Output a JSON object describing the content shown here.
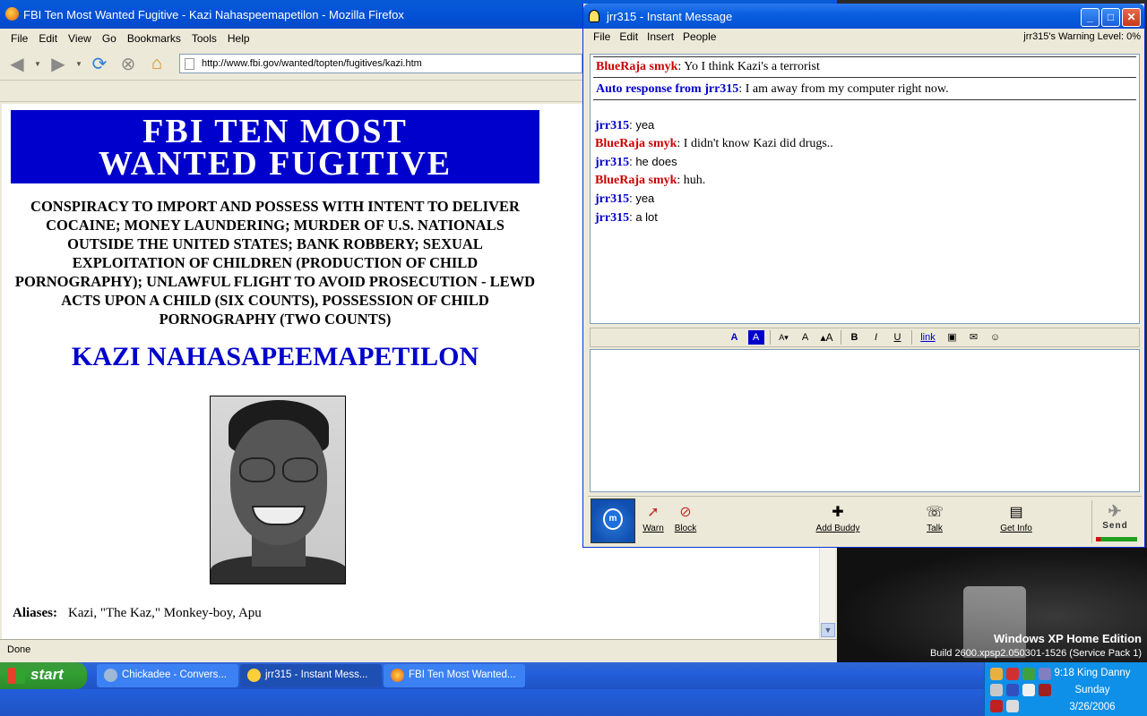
{
  "firefox": {
    "title": "FBI Ten Most Wanted Fugitive - Kazi Nahaspeemapetilon - Mozilla Firefox",
    "menu": [
      "File",
      "Edit",
      "View",
      "Go",
      "Bookmarks",
      "Tools",
      "Help"
    ],
    "url": "http://www.fbi.gov/wanted/topten/fugitives/kazi.htm",
    "status": "Done",
    "page": {
      "banner_line1": "FBI TEN MOST",
      "banner_line2": "WANTED FUGITIVE",
      "charges": "CONSPIRACY TO IMPORT AND POSSESS WITH INTENT TO DELIVER COCAINE; MONEY LAUNDERING; MURDER OF U.S. NATIONALS OUTSIDE THE UNITED STATES; BANK ROBBERY; SEXUAL EXPLOITATION OF CHILDREN (PRODUCTION OF CHILD PORNOGRAPHY); UNLAWFUL FLIGHT TO AVOID PROSECUTION - LEWD ACTS UPON A CHILD (SIX COUNTS), POSSESSION OF CHILD PORNOGRAPHY (TWO COUNTS)",
      "fugitive_name": "KAZI NAHASAPEEMAPETILON",
      "aliases_label": "Aliases:",
      "aliases_value": "Kazi, \"The Kaz,\" Monkey-boy, Apu"
    }
  },
  "aim": {
    "title": "jrr315 - Instant Message",
    "menu": [
      "File",
      "Edit",
      "Insert",
      "People"
    ],
    "warning_level": "jrr315's Warning Level: 0%",
    "boxed_messages": [
      {
        "nick": "BlueRaja smyk",
        "color": "red",
        "text": " Yo I think Kazi's a terrorist"
      },
      {
        "nick": "Auto response from jrr315",
        "color": "blue",
        "text": " I am away from my computer right now."
      }
    ],
    "messages": [
      {
        "nick": "jrr315",
        "color": "blue",
        "text": " yea",
        "serif": false
      },
      {
        "nick": "BlueRaja smyk",
        "color": "red",
        "text": " I didn't know Kazi did drugs..",
        "serif": true
      },
      {
        "nick": "jrr315",
        "color": "blue",
        "text": " he does",
        "serif": false
      },
      {
        "nick": "BlueRaja smyk",
        "color": "red",
        "text": " huh.",
        "serif": true
      },
      {
        "nick": "jrr315",
        "color": "blue",
        "text": " yea",
        "serif": false
      },
      {
        "nick": "jrr315",
        "color": "blue",
        "text": " a lot",
        "serif": false
      }
    ],
    "format_link_label": "link",
    "buttons": {
      "warn": "Warn",
      "block": "Block",
      "add_buddy": "Add Buddy",
      "talk": "Talk",
      "get_info": "Get Info",
      "send": "Send"
    }
  },
  "desktop": {
    "edition": "Windows XP Home Edition",
    "build": "Build 2600.xpsp2.050301-1526 (Service Pack 1)"
  },
  "taskbar": {
    "start": "start",
    "tasks": [
      {
        "label": "Chickadee - Convers...",
        "active": false
      },
      {
        "label": "jrr315 - Instant Mess...",
        "active": true
      },
      {
        "label": "FBI Ten Most Wanted...",
        "active": false
      }
    ],
    "clock_line1": "9:18 King Danny",
    "clock_line2": "Sunday",
    "clock_line3": "3/26/2006"
  }
}
